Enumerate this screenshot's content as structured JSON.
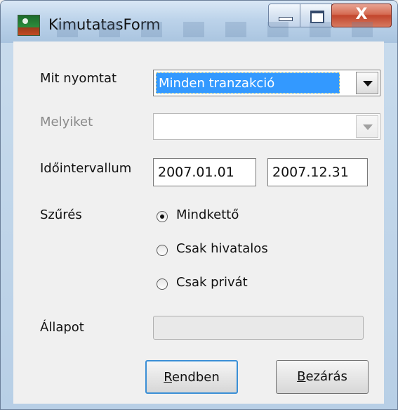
{
  "window": {
    "title": "KimutatasForm"
  },
  "title_buttons": {
    "minimize": "minimize",
    "maximize": "maximize",
    "close": "X"
  },
  "form": {
    "print_label": "Mit nyomtat",
    "print_value": "Minden tranzakció",
    "which_label": "Melyiket",
    "which_value": "",
    "interval_label": "Időintervallum",
    "date_from": "2007.01.01",
    "date_to": "2007.12.31",
    "filter_label": "Szűrés",
    "filter_options": [
      {
        "label": "Mindkettő",
        "checked": true
      },
      {
        "label": "Csak hivatalos",
        "checked": false
      },
      {
        "label": "Csak privát",
        "checked": false
      }
    ],
    "status_label": "Állapot",
    "status_progress": 0
  },
  "buttons": {
    "ok": {
      "mnemonic": "R",
      "rest": "endben"
    },
    "close": {
      "mnemonic": "B",
      "rest": "ezárás"
    }
  },
  "colors": {
    "selection": "#3399ff",
    "titlebar": "#bcd3ea",
    "close_button": "#c2452c"
  }
}
